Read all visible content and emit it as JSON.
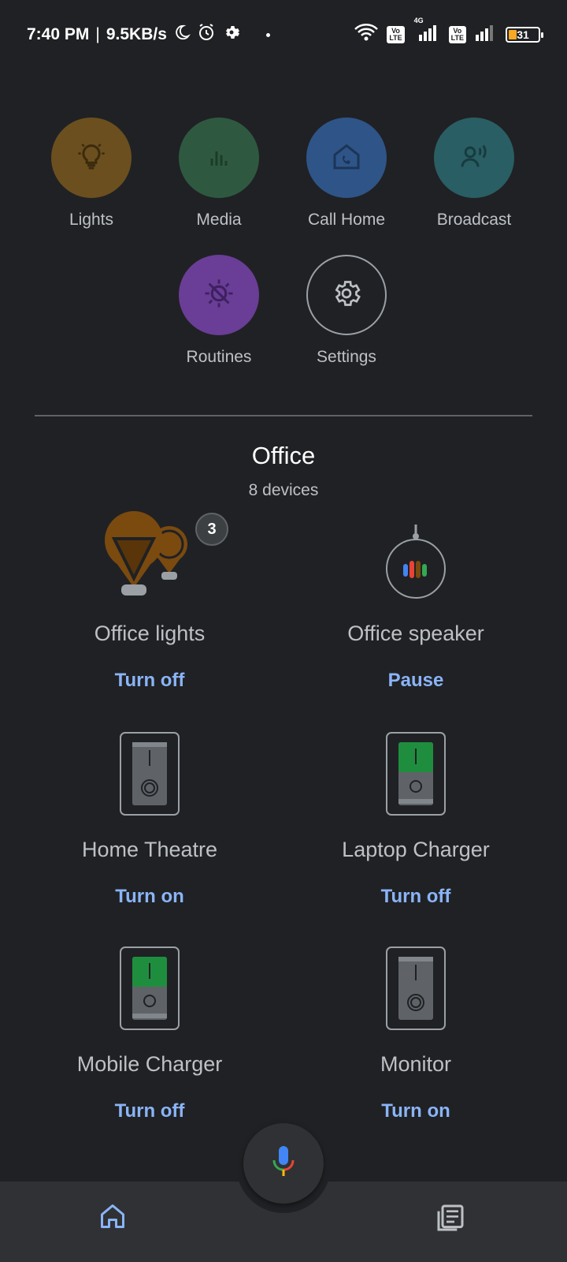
{
  "status_bar": {
    "time": "7:40 PM",
    "separator": "|",
    "speed": "9.5KB/s",
    "network_label": "4G",
    "volte_label": "Vo\nLTE",
    "battery": "31"
  },
  "shortcuts": [
    {
      "label": "Lights",
      "icon": "lightbulb-icon",
      "color": "#6b4f1f"
    },
    {
      "label": "Media",
      "icon": "equalizer-icon",
      "color": "#2e5940"
    },
    {
      "label": "Call Home",
      "icon": "call-home-icon",
      "color": "#2f5488"
    },
    {
      "label": "Broadcast",
      "icon": "broadcast-icon",
      "color": "#295e64"
    },
    {
      "label": "Routines",
      "icon": "routines-icon",
      "color": "#6a3d96"
    },
    {
      "label": "Settings",
      "icon": "gear-icon",
      "color": "transparent"
    }
  ],
  "room": {
    "title": "Office",
    "subtitle": "8 devices"
  },
  "devices": [
    {
      "name": "Office lights",
      "action": "Turn off",
      "badge": "3",
      "icon": "light-bulbs-icon"
    },
    {
      "name": "Office speaker",
      "action": "Pause",
      "icon": "smart-speaker-icon"
    },
    {
      "name": "Home Theatre",
      "action": "Turn on",
      "icon": "plug-off-icon"
    },
    {
      "name": "Laptop Charger",
      "action": "Turn off",
      "icon": "plug-on-icon"
    },
    {
      "name": "Mobile Charger",
      "action": "Turn off",
      "icon": "plug-on-icon"
    },
    {
      "name": "Monitor",
      "action": "Turn on",
      "icon": "plug-off-icon"
    }
  ],
  "colors": {
    "background": "#202124",
    "action_blue": "#8ab4f8",
    "plug_on": "#1e8e3e",
    "bulb": "#7a4a0f"
  },
  "bottom_nav": {
    "home_icon": "home-icon",
    "mic_icon": "mic-icon",
    "feed_icon": "feed-icon"
  }
}
